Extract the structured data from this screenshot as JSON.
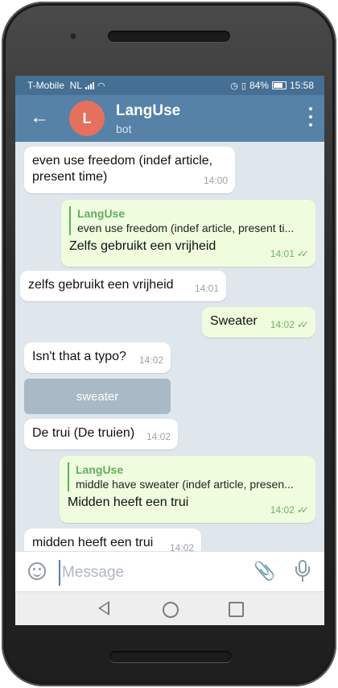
{
  "status_bar": {
    "carrier": "T-Mobile  NL",
    "battery": "84%",
    "time": "15:58"
  },
  "header": {
    "avatar_letter": "L",
    "chat_name": "LangUse",
    "chat_subtitle": "bot"
  },
  "messages": [
    {
      "dir": "in",
      "text": "even use freedom (indef article,\npresent time)",
      "time": "14:00"
    },
    {
      "dir": "out",
      "reply_name": "LangUse",
      "reply_text": "even use freedom (indef article, present ti...",
      "text": "Zelfs gebruikt een vrijheid",
      "time": "14:01"
    },
    {
      "dir": "in",
      "text": "zelfs gebruikt een vrijheid",
      "time": "14:01"
    },
    {
      "dir": "out",
      "text": "Sweater",
      "time": "14:02"
    },
    {
      "dir": "in",
      "text": "Isn't that a typo?",
      "time": "14:02"
    },
    {
      "dir": "in",
      "text": "De trui (De truien)",
      "time": "14:02"
    },
    {
      "dir": "out",
      "reply_name": "LangUse",
      "reply_text": "middle have sweater (indef article, presen...",
      "text": "Midden heeft een trui",
      "time": "14:02"
    },
    {
      "dir": "in",
      "text": "midden heeft een trui",
      "time": "14:02"
    }
  ],
  "keyboard_button": {
    "label": "sweater"
  },
  "input": {
    "placeholder": "Message"
  },
  "icons": {
    "back": "arrow-left-icon",
    "menu": "more-vertical-icon",
    "emoji": "smile-icon",
    "attach": "paperclip-icon",
    "mic": "microphone-icon"
  },
  "colors": {
    "header": "#5682a8",
    "status_bar": "#456f93",
    "outgoing_bubble": "#effdde",
    "accent_green": "#5fae5b",
    "avatar": "#e5705e"
  }
}
